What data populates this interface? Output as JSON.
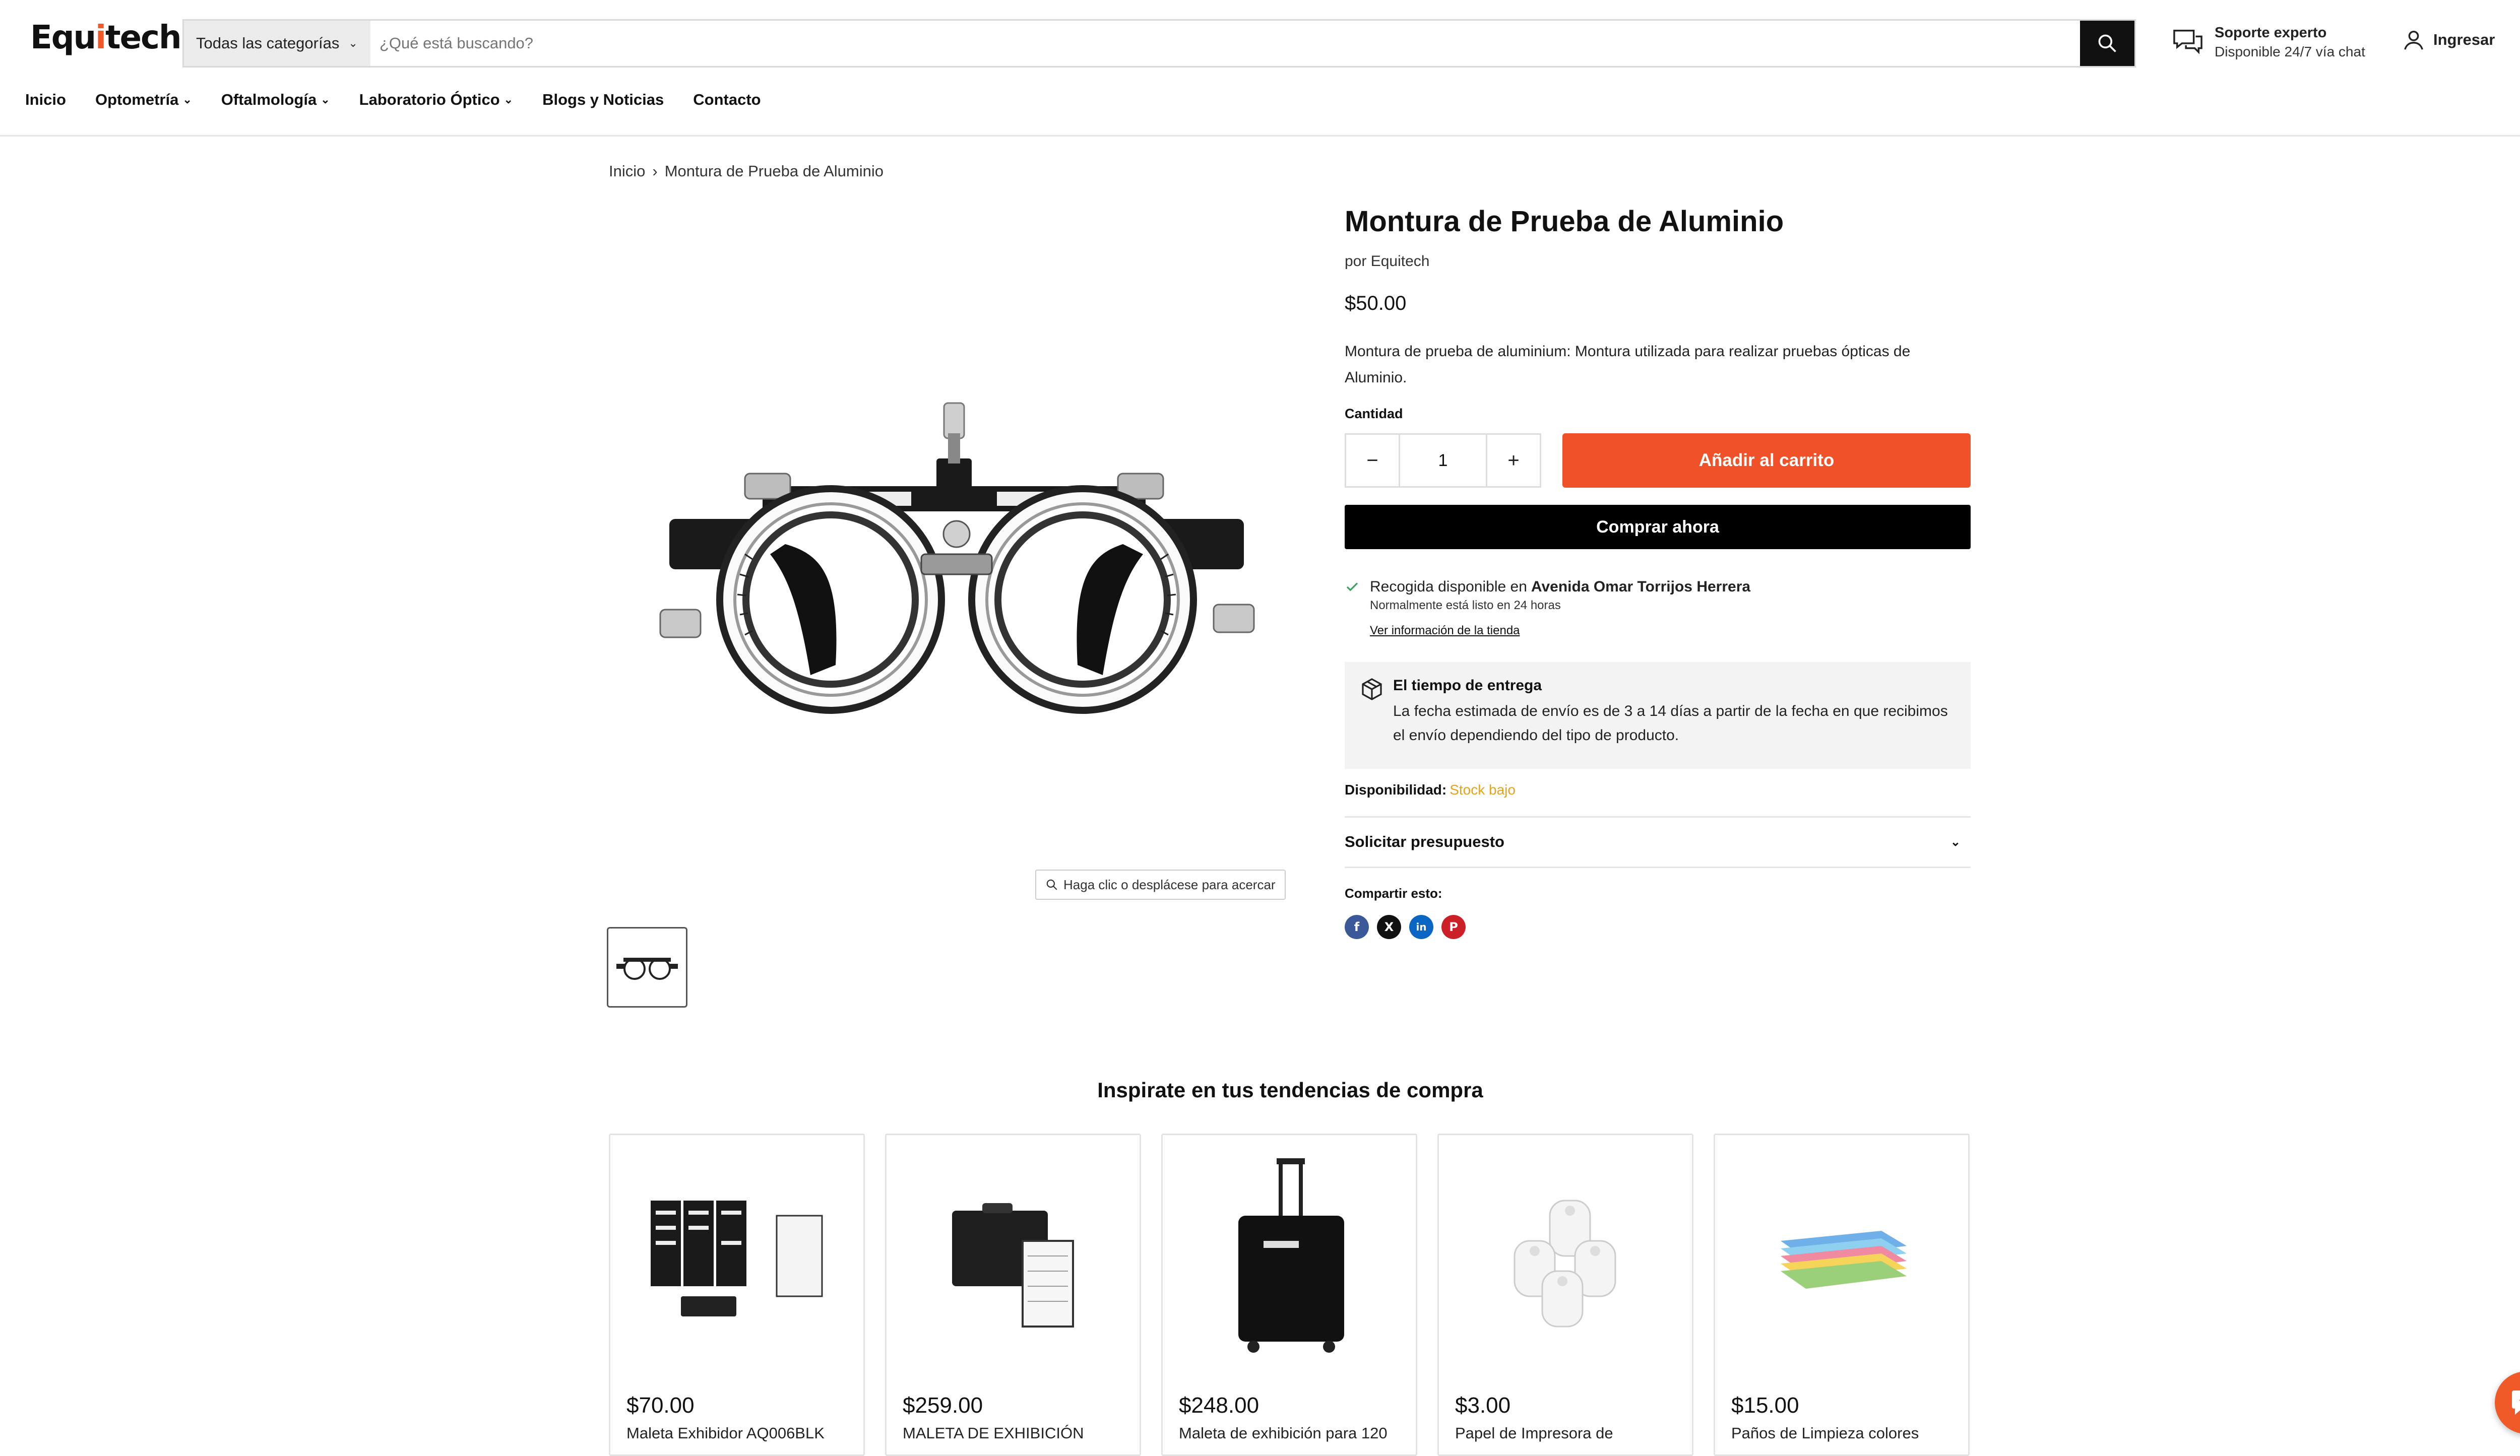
{
  "header": {
    "logo_main": "Equ",
    "logo_accent": "i",
    "logo_tail": "tech",
    "category_label": "Todas las categorías",
    "search_placeholder": "¿Qué está buscando?",
    "support_title": "Soporte experto",
    "support_subtitle": "Disponible 24/7 vía chat",
    "login_label": "Ingresar"
  },
  "nav": {
    "items": [
      {
        "label": "Inicio"
      },
      {
        "label": "Optometría"
      },
      {
        "label": "Oftalmología"
      },
      {
        "label": "Laboratorio Óptico"
      },
      {
        "label": "Blogs y Noticias"
      },
      {
        "label": "Contacto"
      }
    ]
  },
  "breadcrumb": {
    "home": "Inicio",
    "separator": "›",
    "current": "Montura de Prueba de Aluminio"
  },
  "gallery": {
    "zoom_hint": "Haga clic o desplácese para acercar"
  },
  "product": {
    "title": "Montura de Prueba de Aluminio",
    "vendor": "por Equitech",
    "price": "$50.00",
    "description": "Montura de prueba de aluminium: Montura utilizada para realizar pruebas ópticas de Aluminio.",
    "quantity_label": "Cantidad",
    "quantity_value": "1",
    "minus": "−",
    "plus": "+",
    "add_to_cart": "Añadir al carrito",
    "buy_now": "Comprar ahora",
    "pickup_prefix": "Recogida disponible en ",
    "pickup_location": "Avenida Omar Torrijos Herrera",
    "pickup_ready": "Normalmente está listo en 24 horas",
    "pickup_link": "Ver información de la tienda",
    "delivery_title": "El tiempo de entrega",
    "delivery_text": "La fecha estimada de envío es de 3 a 14 días a partir de la fecha en que recibimos el envío dependiendo del tipo de producto.",
    "availability_label": "Disponibilidad:",
    "availability_value": "Stock bajo",
    "quote_label": "Solicitar presupuesto",
    "share_label": "Compartir esto:"
  },
  "recommendations": {
    "title": "Inspirate en tus tendencias de compra",
    "items": [
      {
        "price": "$70.00",
        "name": "Maleta Exhibidor AQ006BLK"
      },
      {
        "price": "$259.00",
        "name": "MALETA DE EXHIBICIÓN"
      },
      {
        "price": "$248.00",
        "name": "Maleta de exhibición para 120"
      },
      {
        "price": "$3.00",
        "name": "Papel de Impresora de"
      },
      {
        "price": "$15.00",
        "name": "Paños de Limpieza colores"
      }
    ]
  },
  "colors": {
    "brand_orange": "#f05128",
    "stock_low": "#e6a21a",
    "dark": "#111111"
  },
  "icons": [
    "search-icon",
    "chat-support-icon",
    "user-icon",
    "bag-icon",
    "check-icon",
    "box-icon",
    "zoom-icon",
    "facebook-icon",
    "x-icon",
    "linkedin-icon",
    "pinterest-icon",
    "chat-bubble-icon"
  ]
}
